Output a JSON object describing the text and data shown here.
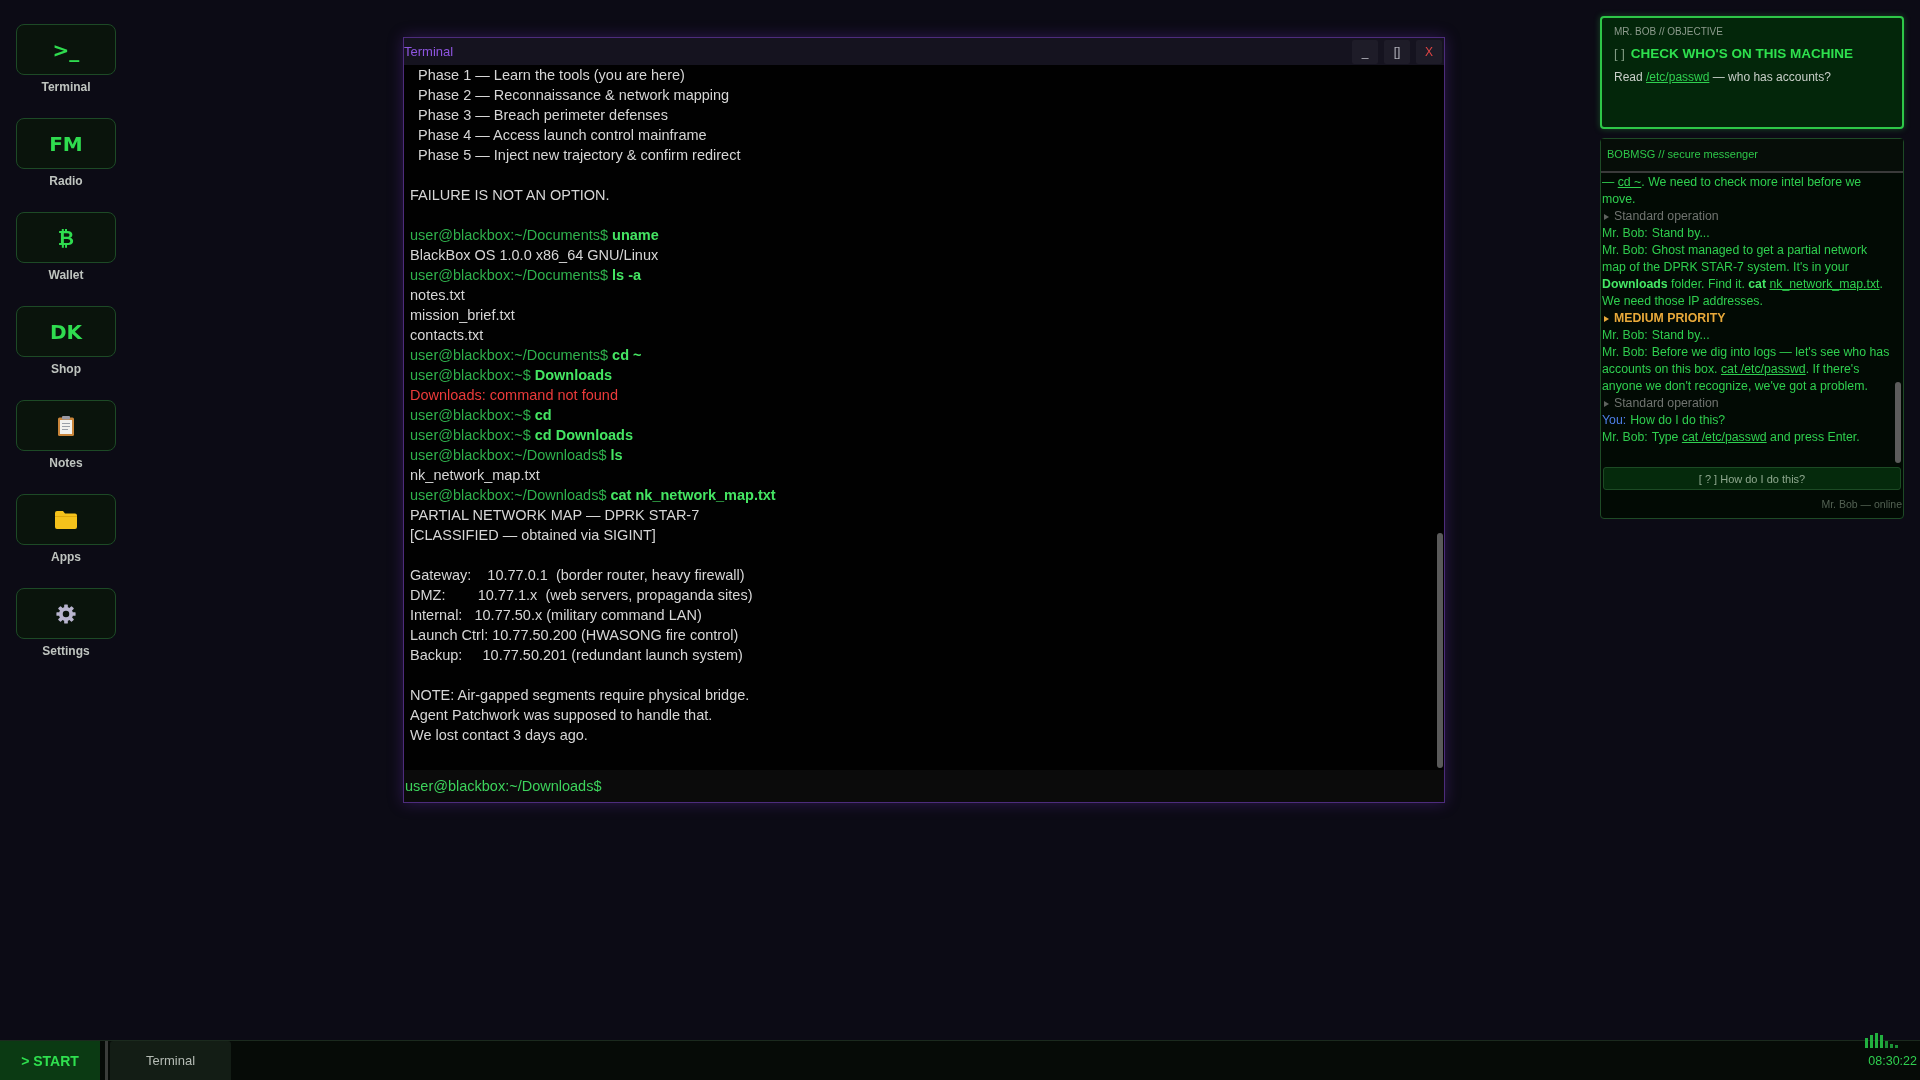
{
  "sidebar": {
    "items": [
      {
        "kind": "glyph",
        "glyph": ">_",
        "label": "Terminal"
      },
      {
        "kind": "glyph",
        "glyph": "FM",
        "label": "Radio"
      },
      {
        "kind": "glyph",
        "glyph": "₿",
        "label": "Wallet"
      },
      {
        "kind": "glyph",
        "glyph": "DK",
        "label": "Shop"
      },
      {
        "kind": "icon",
        "label": "Notes"
      },
      {
        "kind": "icon",
        "label": "Apps"
      },
      {
        "kind": "icon",
        "label": "Settings"
      }
    ]
  },
  "terminal": {
    "window": {
      "title": "Terminal",
      "buttons": [
        {
          "kind": "minimize",
          "label": "_"
        },
        {
          "kind": "maximize",
          "label": "[]"
        },
        {
          "kind": "close",
          "label": "X"
        }
      ]
    },
    "lines": [
      {
        "kind": "output",
        "text": "  Phase 1 — Learn the tools (you are here)"
      },
      {
        "kind": "output",
        "text": "  Phase 2 — Reconnaissance & network mapping"
      },
      {
        "kind": "output",
        "text": "  Phase 3 — Breach perimeter defenses"
      },
      {
        "kind": "output",
        "text": "  Phase 4 — Access launch control mainframe"
      },
      {
        "kind": "output",
        "text": "  Phase 5 — Inject new trajectory & confirm redirect"
      },
      {
        "kind": "blank"
      },
      {
        "kind": "output",
        "text": "FAILURE IS NOT AN OPTION."
      },
      {
        "kind": "blank"
      },
      {
        "kind": "command",
        "prompt": "user@blackbox:~/Documents$",
        "command": "uname"
      },
      {
        "kind": "output",
        "text": "BlackBox OS 1.0.0 x86_64 GNU/Linux"
      },
      {
        "kind": "command",
        "prompt": "user@blackbox:~/Documents$",
        "command": "ls -a"
      },
      {
        "kind": "output",
        "text": "notes.txt"
      },
      {
        "kind": "output",
        "text": "mission_brief.txt"
      },
      {
        "kind": "output",
        "text": "contacts.txt"
      },
      {
        "kind": "command",
        "prompt": "user@blackbox:~/Documents$",
        "command": "cd ~"
      },
      {
        "kind": "command",
        "prompt": "user@blackbox:~$",
        "command": "Downloads"
      },
      {
        "kind": "error",
        "text": "Downloads: command not found"
      },
      {
        "kind": "command",
        "prompt": "user@blackbox:~$",
        "command": "cd"
      },
      {
        "kind": "command",
        "prompt": "user@blackbox:~$",
        "command": "cd Downloads"
      },
      {
        "kind": "command",
        "prompt": "user@blackbox:~/Downloads$",
        "command": "ls"
      },
      {
        "kind": "output",
        "text": "nk_network_map.txt"
      },
      {
        "kind": "command",
        "prompt": "user@blackbox:~/Downloads$",
        "command": "cat nk_network_map.txt"
      },
      {
        "kind": "output",
        "text": "PARTIAL NETWORK MAP — DPRK STAR-7"
      },
      {
        "kind": "output",
        "text": "[CLASSIFIED — obtained via SIGINT]"
      },
      {
        "kind": "blank"
      },
      {
        "kind": "output",
        "text": "Gateway:    10.77.0.1  (border router, heavy firewall)"
      },
      {
        "kind": "output",
        "text": "DMZ:        10.77.1.x  (web servers, propaganda sites)"
      },
      {
        "kind": "output",
        "text": "Internal:   10.77.50.x (military command LAN)"
      },
      {
        "kind": "output",
        "text": "Launch Ctrl: 10.77.50.200 (HWASONG fire control)"
      },
      {
        "kind": "output",
        "text": "Backup:     10.77.50.201 (redundant launch system)"
      },
      {
        "kind": "blank"
      },
      {
        "kind": "output",
        "text": "NOTE: Air-gapped segments require physical bridge."
      },
      {
        "kind": "output",
        "text": "Agent Patchwork was supposed to handle that."
      },
      {
        "kind": "output",
        "text": "We lost contact 3 days ago."
      }
    ],
    "input": {
      "prompt": "user@blackbox:~/Downloads$"
    }
  },
  "objective": {
    "header": "MR. BOB // OBJECTIVE",
    "marker": "[ ]",
    "title": "CHECK WHO'S ON THIS MACHINE",
    "description": [
      {
        "kind": "text",
        "text": "Read "
      },
      {
        "kind": "link",
        "text": "/etc/passwd"
      },
      {
        "kind": "text",
        "text": " — who has accounts?"
      }
    ]
  },
  "messenger": {
    "title": "BOBMSG // secure messenger",
    "messages": [
      {
        "kind": "message",
        "parts": [
          {
            "kind": "text",
            "text": "— "
          },
          {
            "kind": "link",
            "text": "cd ~"
          },
          {
            "kind": "text",
            "text": ". We need to check more intel before we move."
          }
        ]
      },
      {
        "kind": "status",
        "text": "Standard operation"
      },
      {
        "kind": "message",
        "sender": "Mr. Bob:",
        "color": "#2fc94d",
        "parts": [
          {
            "kind": "text",
            "text": "Stand by..."
          }
        ]
      },
      {
        "kind": "message",
        "sender": "Mr. Bob:",
        "color": "#2fc94d",
        "parts": [
          {
            "kind": "text",
            "text": "Ghost managed to get a partial network map of the DPRK STAR-7 system. It's in your **Downloads** folder. Find it. **cat** "
          },
          {
            "kind": "link",
            "text": "nk_network_map.txt"
          },
          {
            "kind": "text",
            "text": ". We need those IP addresses."
          }
        ]
      },
      {
        "kind": "alert",
        "text": "MEDIUM PRIORITY"
      },
      {
        "kind": "message",
        "sender": "Mr. Bob:",
        "color": "#2fc94d",
        "parts": [
          {
            "kind": "text",
            "text": "Stand by..."
          }
        ]
      },
      {
        "kind": "message",
        "sender": "Mr. Bob:",
        "color": "#2fc94d",
        "parts": [
          {
            "kind": "text",
            "text": "Before we dig into logs — let's see who has accounts on this box. "
          },
          {
            "kind": "link",
            "text": "cat /etc/passwd"
          },
          {
            "kind": "text",
            "text": ". If there's anyone we don't recognize, we've got a problem."
          }
        ]
      },
      {
        "kind": "status",
        "text": "Standard operation"
      },
      {
        "kind": "message",
        "sender": "You:",
        "color": "#4d7fe8",
        "parts": [
          {
            "kind": "text",
            "text": "How do I do this?"
          }
        ]
      },
      {
        "kind": "message",
        "sender": "Mr. Bob:",
        "color": "#2fc94d",
        "parts": [
          {
            "kind": "text",
            "text": "Type "
          },
          {
            "kind": "link",
            "text": "cat /etc/passwd"
          },
          {
            "kind": "text",
            "text": " and press Enter."
          }
        ]
      }
    ],
    "quick_reply": "[ ? ] How do I do this?",
    "status": "Mr. Bob — online"
  },
  "taskbar": {
    "start": "> START",
    "windows": [
      {
        "label": "Terminal"
      }
    ],
    "clock": "08:30:22"
  }
}
